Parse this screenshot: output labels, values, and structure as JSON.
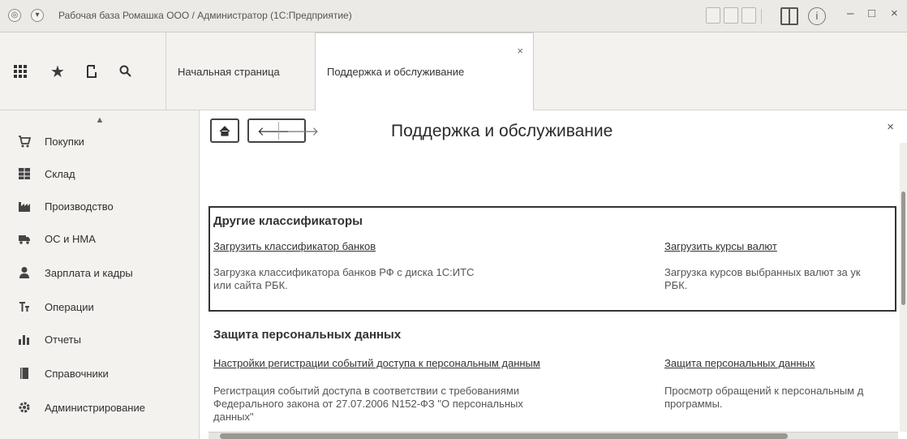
{
  "window": {
    "title": "Рабочая база Ромашка ООО / Администратор  (1С:Предприятие)",
    "controls": {
      "minimize": "–",
      "maximize": "□",
      "close": "×"
    }
  },
  "panel": {
    "icons": [
      "apps-grid-icon",
      "star-icon",
      "history-icon",
      "search-icon"
    ],
    "tabs": [
      {
        "label": "Начальная страница",
        "active": false
      },
      {
        "label": "Поддержка и обслуживание",
        "active": true,
        "close": "×"
      }
    ]
  },
  "sidebar": {
    "items": [
      {
        "label": "Покупки",
        "icon": "cart-icon"
      },
      {
        "label": "Склад",
        "icon": "warehouse-icon"
      },
      {
        "label": "Производство",
        "icon": "factory-icon"
      },
      {
        "label": "ОС и НМА",
        "icon": "truck-icon"
      },
      {
        "label": "Зарплата и кадры",
        "icon": "person-icon"
      },
      {
        "label": "Операции",
        "icon": "operations-icon"
      },
      {
        "label": "Отчеты",
        "icon": "bar-chart-icon"
      },
      {
        "label": "Справочники",
        "icon": "book-icon"
      },
      {
        "label": "Администрирование",
        "icon": "gear-icon"
      }
    ]
  },
  "main": {
    "title": "Поддержка и обслуживание",
    "close": "×",
    "sections": [
      {
        "title": "Другие классификаторы",
        "left": {
          "link": "Загрузить классификатор банков",
          "desc_line1": "Загрузка классификатора банков РФ с диска 1С:ИТС",
          "desc_line2": "или сайта РБК."
        },
        "right": {
          "link": "Загрузить курсы валют",
          "desc_line1": "Загрузка курсов выбранных валют за ук",
          "desc_line2": "РБК."
        }
      },
      {
        "title": "Защита персональных данных",
        "left": {
          "link": "Настройки регистрации событий доступа к персональным данным",
          "desc_line1": "Регистрация событий доступа в соответствии с требованиями",
          "desc_line2": "Федерального закона от 27.07.2006 N152-ФЗ \"О персональных",
          "desc_line3": "данных\""
        },
        "right": {
          "link": "Защита персональных данных",
          "desc_line1": "Просмотр обращений к персональным д",
          "desc_line2": "программы."
        }
      }
    ]
  }
}
